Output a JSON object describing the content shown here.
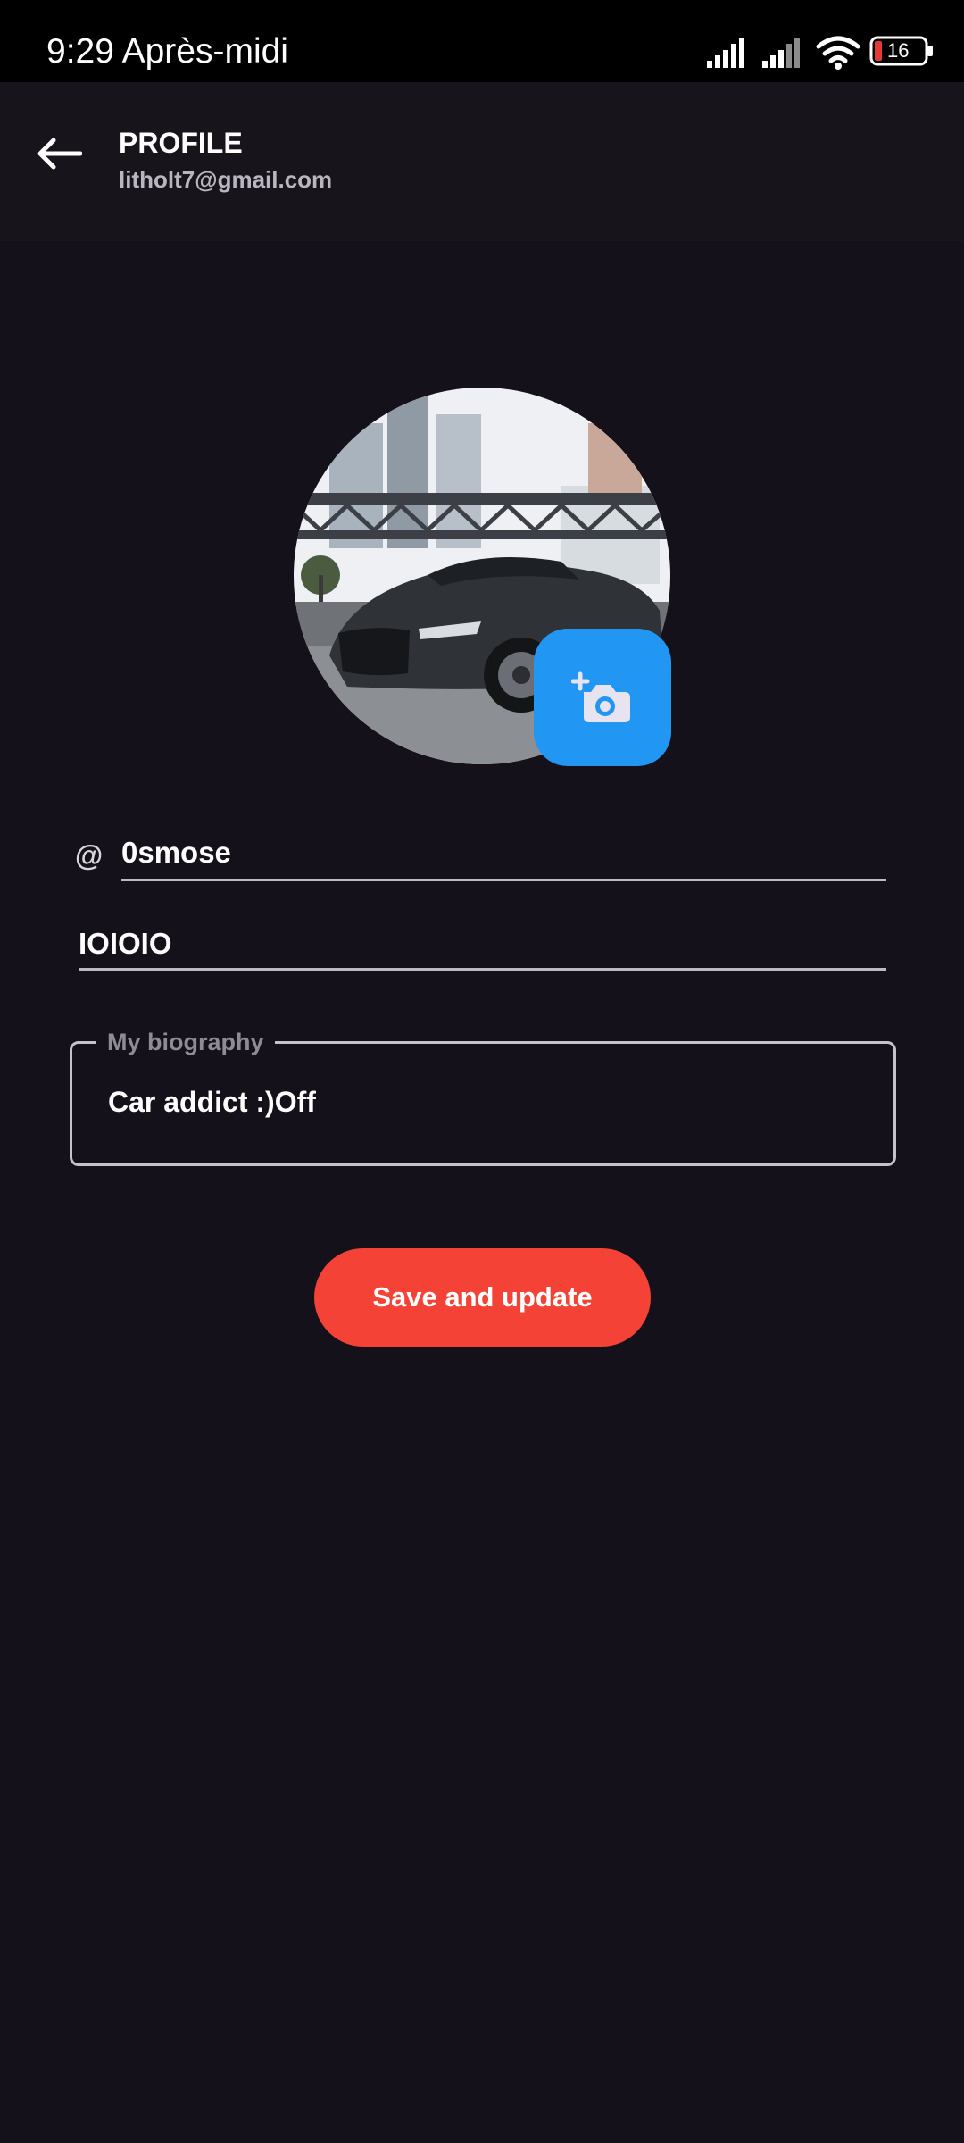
{
  "status_bar": {
    "time": "9:29 Après-midi",
    "battery_level": "16",
    "icons": [
      "signal-icon",
      "signal-icon",
      "wifi-icon",
      "battery-icon"
    ]
  },
  "header": {
    "title": "PROFILE",
    "subtitle": "litholt7@gmail.com",
    "back_icon": "arrow-left-icon"
  },
  "avatar": {
    "alt": "Profile photo",
    "edit_icon": "add-photo-icon"
  },
  "form": {
    "username_prefix": "@",
    "username": "0smose",
    "name": "IOIOIO",
    "biography_label": "My biography",
    "biography": "Car addict :)Off"
  },
  "actions": {
    "save_label": "Save and update"
  },
  "colors": {
    "background": "#14111a",
    "header": "#17141c",
    "accent_blue": "#2196f3",
    "save_red": "#f44336"
  }
}
